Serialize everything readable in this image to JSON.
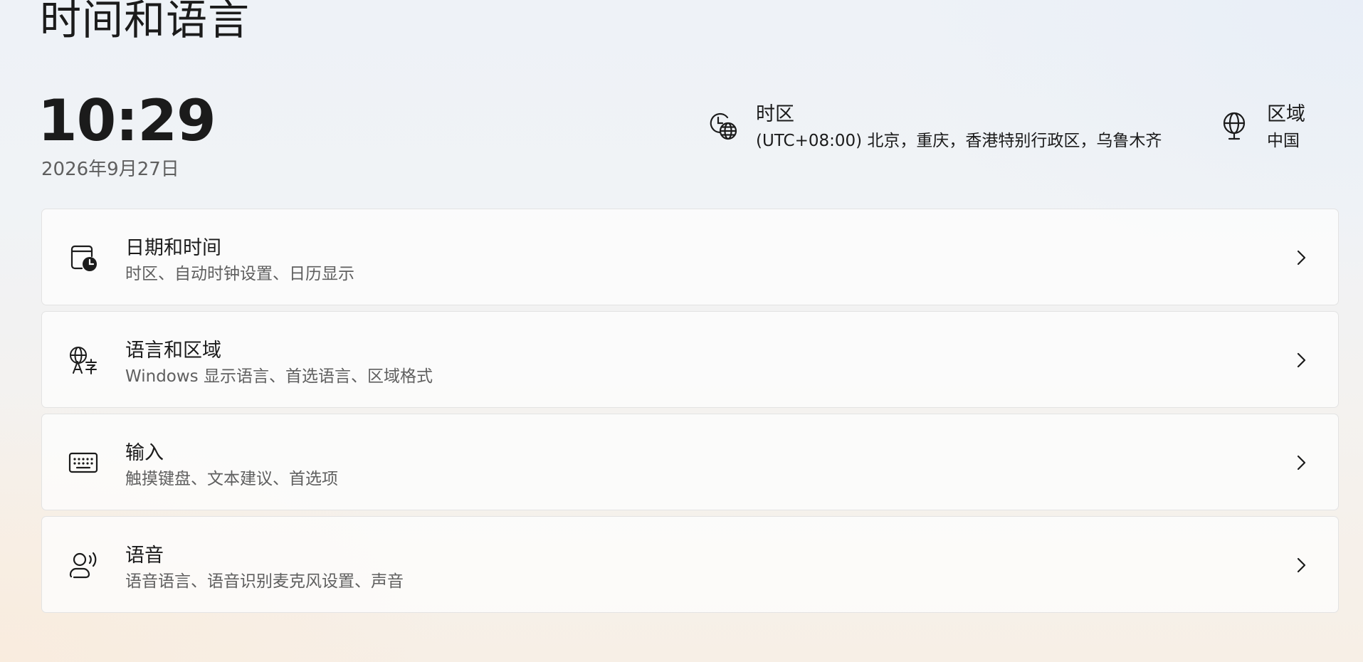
{
  "page": {
    "title": "时间和语言"
  },
  "clock": {
    "time": "10:29",
    "date": "2026年9月27日"
  },
  "timezone": {
    "icon": "timezone-clock-globe-icon",
    "label": "时区",
    "value": "(UTC+08:00) 北京，重庆，香港特别行政区，乌鲁木齐"
  },
  "region": {
    "icon": "globe-icon",
    "label": "区域",
    "value": "中国"
  },
  "cards": [
    {
      "icon": "calendar-clock-icon",
      "title": "日期和时间",
      "subtitle": "时区、自动时钟设置、日历显示"
    },
    {
      "icon": "language-region-icon",
      "title": "语言和区域",
      "subtitle": "Windows 显示语言、首选语言、区域格式"
    },
    {
      "icon": "keyboard-icon",
      "title": "输入",
      "subtitle": "触摸键盘、文本建议、首选项"
    },
    {
      "icon": "speech-icon",
      "title": "语音",
      "subtitle": "语音语言、语音识别麦克风设置、声音"
    }
  ]
}
